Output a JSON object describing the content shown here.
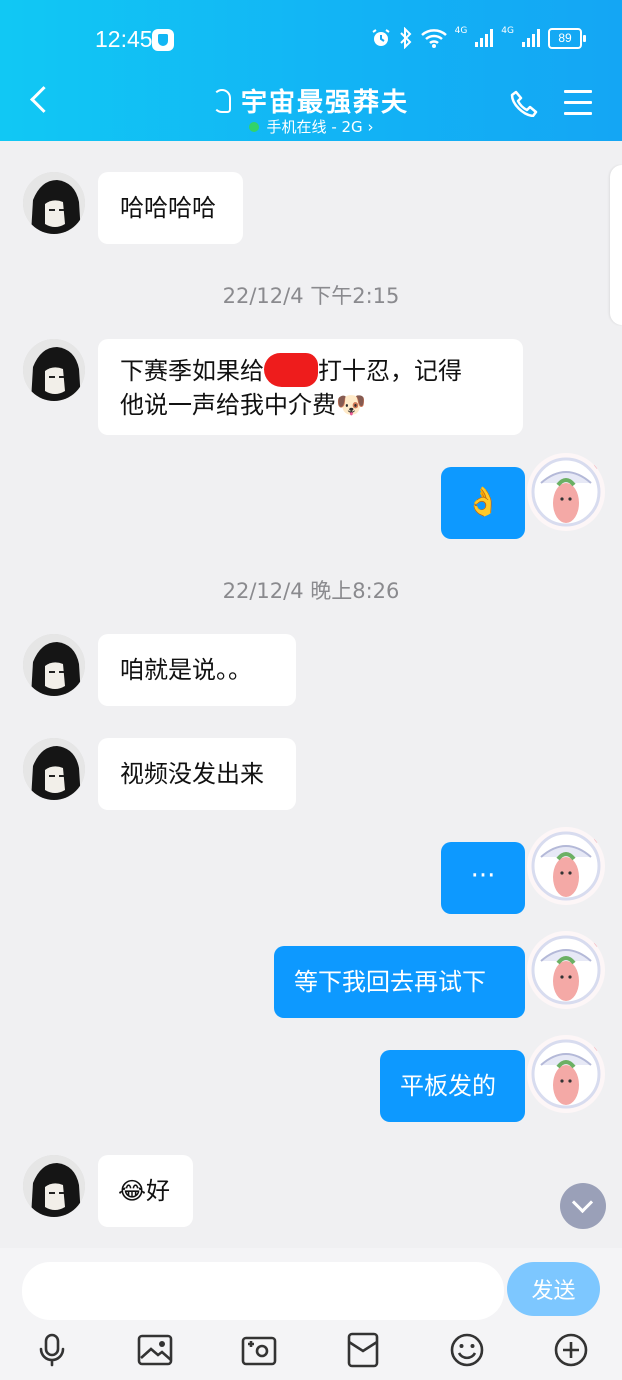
{
  "status_bar": {
    "time": "12:45",
    "net1": "4G",
    "net2": "4G",
    "battery": "89"
  },
  "header": {
    "title": "宇宙最强莽夫",
    "subtitle": "手机在线 - 2G",
    "subtitle_chevron": "›",
    "accent_color": "#12b6f4"
  },
  "messages": {
    "m1": "哈哈哈哈",
    "t1": "22/12/4 下午2:15",
    "m2_line1_pre": "下赛季如果给",
    "m2_line1_post": "打十忍，记得",
    "m2_line2": "他说一声给我中介费🐶",
    "m3": "👌",
    "t2": "22/12/4 晚上8:26",
    "m4": "咱就是说。。",
    "m5": "视频没发出来",
    "m6": "···",
    "m7": "等下我回去再试下",
    "m8": "平板发的",
    "m9": "😂好"
  },
  "input": {
    "placeholder": "",
    "send_label": "发送"
  },
  "toolbar": {
    "icons": [
      "microphone-icon",
      "image-icon",
      "camera-icon",
      "red-packet-icon",
      "emoji-icon",
      "plus-icon"
    ]
  }
}
